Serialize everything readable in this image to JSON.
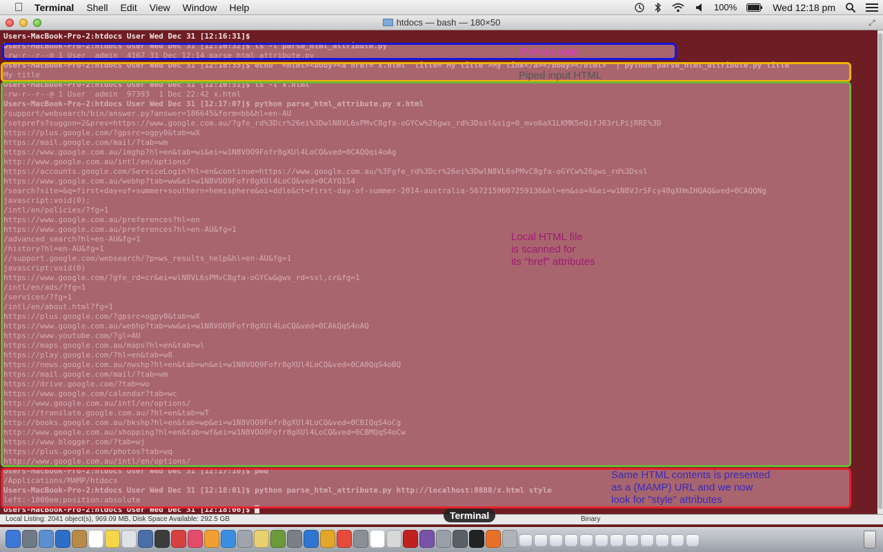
{
  "menubar": {
    "app_name": "Terminal",
    "items": [
      "Shell",
      "Edit",
      "View",
      "Window",
      "Help"
    ],
    "battery": "100%",
    "clock": "Wed 12:18 pm"
  },
  "window": {
    "title": "htdocs — bash — 180×50"
  },
  "terminal": {
    "lines": [
      {
        "text": "Users-MacBook-Pro-2:htdocs User Wed Dec 31 [12:16:31]$",
        "prompt": true
      },
      {
        "text": "Users-MacBook-Pro-2:htdocs User Wed Dec 31 [12:16:32]$ ls -l parse_html_attribute.py",
        "prompt": true
      },
      {
        "text": "-rw-r--r--@ 1 User  admin  4167 31 Dec 12:14 parse_html_attribute.py",
        "prompt": false
      },
      {
        "text": "Users-MacBook-Pro-2:htdocs User Wed Dec 31 [12:16:35]$ echo \"<html><body><a href='x.html' title='My title'>My link</a></body></html>\" | python parse_html_attribute.py title",
        "prompt": true
      },
      {
        "text": "My title",
        "prompt": false
      },
      {
        "text": "Users-MacBook-Pro-2:htdocs User Wed Dec 31 [12:16:51]$ ls -l x.html",
        "prompt": true
      },
      {
        "text": "-rw-r--r--@ 1 User  admin  97393  1 Dec 22:42 x.html",
        "prompt": false
      },
      {
        "text": "Users-MacBook-Pro-2:htdocs User Wed Dec 31 [12:17:07]$ python parse_html_attribute.py x.html",
        "prompt": true
      },
      {
        "text": "/support/websearch/bin/answer.py?answer=186645&form=bb&hl=en-AU",
        "prompt": false
      },
      {
        "text": "/setprefs?suggon=2&prev=https://www.google.com.au/?gfe_rd%3Dcr%26ei%3DwlN8VL6sPMvC8gfa-oGYCw%26gws_rd%3Dssl&sig=0_mvo6aX1LKMK5eQifJ63rLPijRRE%3D",
        "prompt": false
      },
      {
        "text": "https://plus.google.com/?gpsrc=ogpy0&tab=wX",
        "prompt": false
      },
      {
        "text": "https://mail.google.com/mail/?tab=wm",
        "prompt": false
      },
      {
        "text": "https://www.google.com.au/imghp?hl=en&tab=wi&ei=w1N8VOO9Fofr8gXUl4LoCQ&ved=0CAQQqi4oAg",
        "prompt": false
      },
      {
        "text": "http://www.google.com.au/intl/en/options/",
        "prompt": false
      },
      {
        "text": "https://accounts.google.com/ServiceLogin?hl=en&continue=https://www.google.com.au/%3Fgfe_rd%3Dcr%26ei%3DwlN8VL6sPMvC8gfa-oGYCw%26gws_rd%3Dssl",
        "prompt": false
      },
      {
        "text": "https://www.google.com.au/webhp?tab=ww&ei=w1N8VOO9Fofr8gXUl4LoCQ&ved=0CAYQ1S4",
        "prompt": false
      },
      {
        "text": "/search?site=&q=first+day+of+summer+southern+hemisphere&oi=ddle&ct=first-day-of-summer-2014-australia-5672159607259136&hl=en&sa=X&ei=w1N8VJrSFcy48gXHmIHQAQ&ved=0CAQQNg",
        "prompt": false
      },
      {
        "text": "javascript:void(0);",
        "prompt": false
      },
      {
        "text": "/intl/en/policies/?fg=1",
        "prompt": false
      },
      {
        "text": "https://www.google.com.au/preferences?hl=en",
        "prompt": false
      },
      {
        "text": "https://www.google.com.au/preferences?hl=en-AU&fg=1",
        "prompt": false
      },
      {
        "text": "/advanced_search?hl=en-AU&fg=1",
        "prompt": false
      },
      {
        "text": "/history?hl=en-AU&fg=1",
        "prompt": false
      },
      {
        "text": "//support.google.com/websearch/?p=ws_results_help&hl=en-AU&fg=1",
        "prompt": false
      },
      {
        "text": "javascript:void(0)",
        "prompt": false
      },
      {
        "text": "https://www.google.com/?gfe_rd=cr&ei=wlN8VL6sPMvC8gfa-oGYCw&gws_rd=ssl,cr&fg=1",
        "prompt": false
      },
      {
        "text": "/intl/en/ads/?fg=1",
        "prompt": false
      },
      {
        "text": "/services/?fg=1",
        "prompt": false
      },
      {
        "text": "/intl/en/about.html?fg=1",
        "prompt": false
      },
      {
        "text": "https://plus.google.com/?gpsrc=ogpy0&tab=wX",
        "prompt": false
      },
      {
        "text": "https://www.google.com.au/webhp?tab=ww&ei=w1N8VOO9Fofr8gXUl4LoCQ&ved=0CAkQqS4oAQ",
        "prompt": false
      },
      {
        "text": "https://www.youtube.com/?gl=AU",
        "prompt": false
      },
      {
        "text": "https://maps.google.com.au/maps?hl=en&tab=wl",
        "prompt": false
      },
      {
        "text": "https://play.google.com/?hl=en&tab=w8",
        "prompt": false
      },
      {
        "text": "https://news.google.com.au/nwshp?hl=en&tab=wn&ei=w1N8VOO9Fofr8gXUl4LoCQ&ved=0CA0QqS4oBQ",
        "prompt": false
      },
      {
        "text": "https://mail.google.com/mail/?tab=wm",
        "prompt": false
      },
      {
        "text": "https://drive.google.com/?tab=wo",
        "prompt": false
      },
      {
        "text": "https://www.google.com/calendar?tab=wc",
        "prompt": false
      },
      {
        "text": "http://www.google.com.au/intl/en/options/",
        "prompt": false
      },
      {
        "text": "https://translate.google.com.au/?hl=en&tab=wT",
        "prompt": false
      },
      {
        "text": "http://books.google.com.au/bkshp?hl=en&tab=wp&ei=w1N8VOO9Fofr8gXUl4LoCQ&ved=0CBIQqS4oCg",
        "prompt": false
      },
      {
        "text": "http://www.google.com.au/shopping?hl=en&tab=wf&ei=w1N8VOO9Fofr8gXUl4LoCQ&ved=0CBMQqS4oCw",
        "prompt": false
      },
      {
        "text": "https://www.blogger.com/?tab=wj",
        "prompt": false
      },
      {
        "text": "https://plus.google.com/photos?tab=wq",
        "prompt": false
      },
      {
        "text": "http://www.google.com.au/intl/en/options/",
        "prompt": false
      },
      {
        "text": "Users-MacBook-Pro-2:htdocs User Wed Dec 31 [12:17:10]$ pwd",
        "prompt": true
      },
      {
        "text": "/Applications/MAMP/htdocs",
        "prompt": false
      },
      {
        "text": "Users-MacBook-Pro-2:htdocs User Wed Dec 31 [12:18:01]$ python parse_html_attribute.py http://localhost:8888/x.html style",
        "prompt": true
      },
      {
        "text": "left:-1000em;position:absolute",
        "prompt": false
      },
      {
        "text": "Users-MacBook-Pro-2:htdocs User Wed Dec 31 [12:18:06]$ ",
        "prompt": true
      }
    ]
  },
  "annotations": {
    "python_code": "Python code",
    "piped_input": "Piped input HTML",
    "local_file": "Local HTML file\nis scanned for\nits \"href\" attributes",
    "same_html": "Same HTML contents is presented\nas a (MAMP) URL and we now\nlook for \"style\" attributes"
  },
  "statusbar": {
    "left": "Local Listing: 2041 object(s), 969.09 MB, Disk Space Available: 292.5 GB",
    "right": "Binary"
  },
  "dock": {
    "tooltip": "Terminal"
  },
  "colors": {
    "terminal_bg": "#6e1d23",
    "box_python": "#1515e0",
    "box_piped": "#f0b400",
    "box_local": "#6ab83a",
    "box_url": "#e4202a"
  }
}
